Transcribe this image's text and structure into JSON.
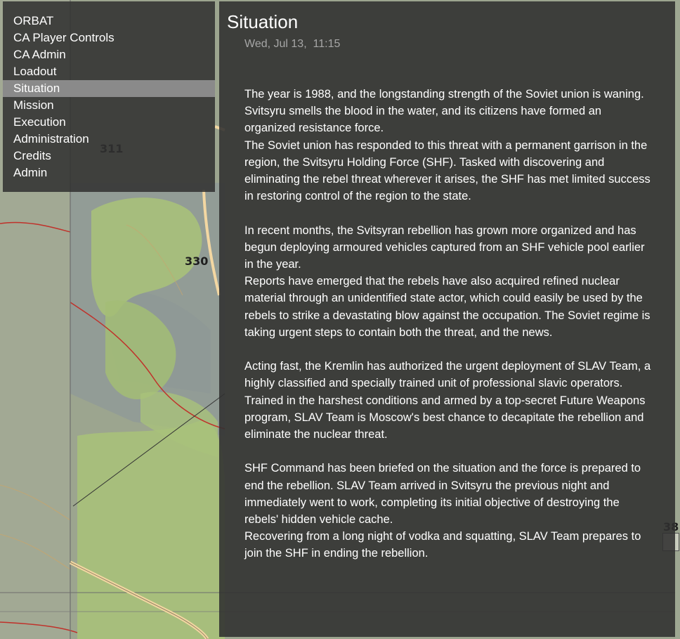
{
  "map": {
    "grid_labels": [
      "311",
      "330",
      "38"
    ],
    "colors": {
      "terrain": "#9aa592",
      "forest": "#a9c27a",
      "road": "#f3d7a2",
      "boundary": "#c0312a"
    }
  },
  "menu": {
    "items": [
      {
        "label": "ORBAT"
      },
      {
        "label": "CA Player Controls"
      },
      {
        "label": "CA Admin"
      },
      {
        "label": "Loadout"
      },
      {
        "label": "Situation",
        "active": true
      },
      {
        "label": "Mission"
      },
      {
        "label": "Execution"
      },
      {
        "label": "Administration"
      },
      {
        "label": "Credits"
      },
      {
        "label": "Admin"
      }
    ]
  },
  "panel": {
    "title": "Situation",
    "date": "Wed, Jul 13,  11:15",
    "paragraphs": [
      "The year is 1988, and the longstanding strength of the Soviet union is waning. Svitsyru smells the blood in the water, and its citizens have formed an organized resistance force.",
      "The Soviet union has responded to this threat with a permanent garrison in the region, the Svitsyru Holding Force (SHF). Tasked with discovering and eliminating the rebel threat wherever it arises, the SHF has met limited success in restoring control of the region to the state.",
      "In recent months, the Svitsyran rebellion has grown more organized and has begun deploying armoured vehicles captured from an SHF vehicle pool earlier in the year.",
      "Reports have emerged that the rebels have also acquired refined nuclear material through an unidentified state actor, which could easily be used by the rebels to strike a devastating blow against the occupation. The Soviet regime is taking urgent steps to contain both the threat, and the news.",
      "Acting fast, the Kremlin has authorized the urgent deployment of SLAV Team, a highly classified and specially trained unit of professional slavic operators. Trained in the harshest conditions and armed by a top-secret Future Weapons program, SLAV Team is Moscow's best chance to decapitate the rebellion and eliminate the nuclear threat.",
      "SHF Command has been briefed on the situation and the force is prepared to end the rebellion. SLAV Team arrived in Svitsyru the previous night and immediately went to work, completing its initial objective of destroying the rebels' hidden vehicle cache.",
      "Recovering from a long night of vodka and squatting, SLAV Team prepares to join the SHF in ending the rebellion."
    ]
  }
}
